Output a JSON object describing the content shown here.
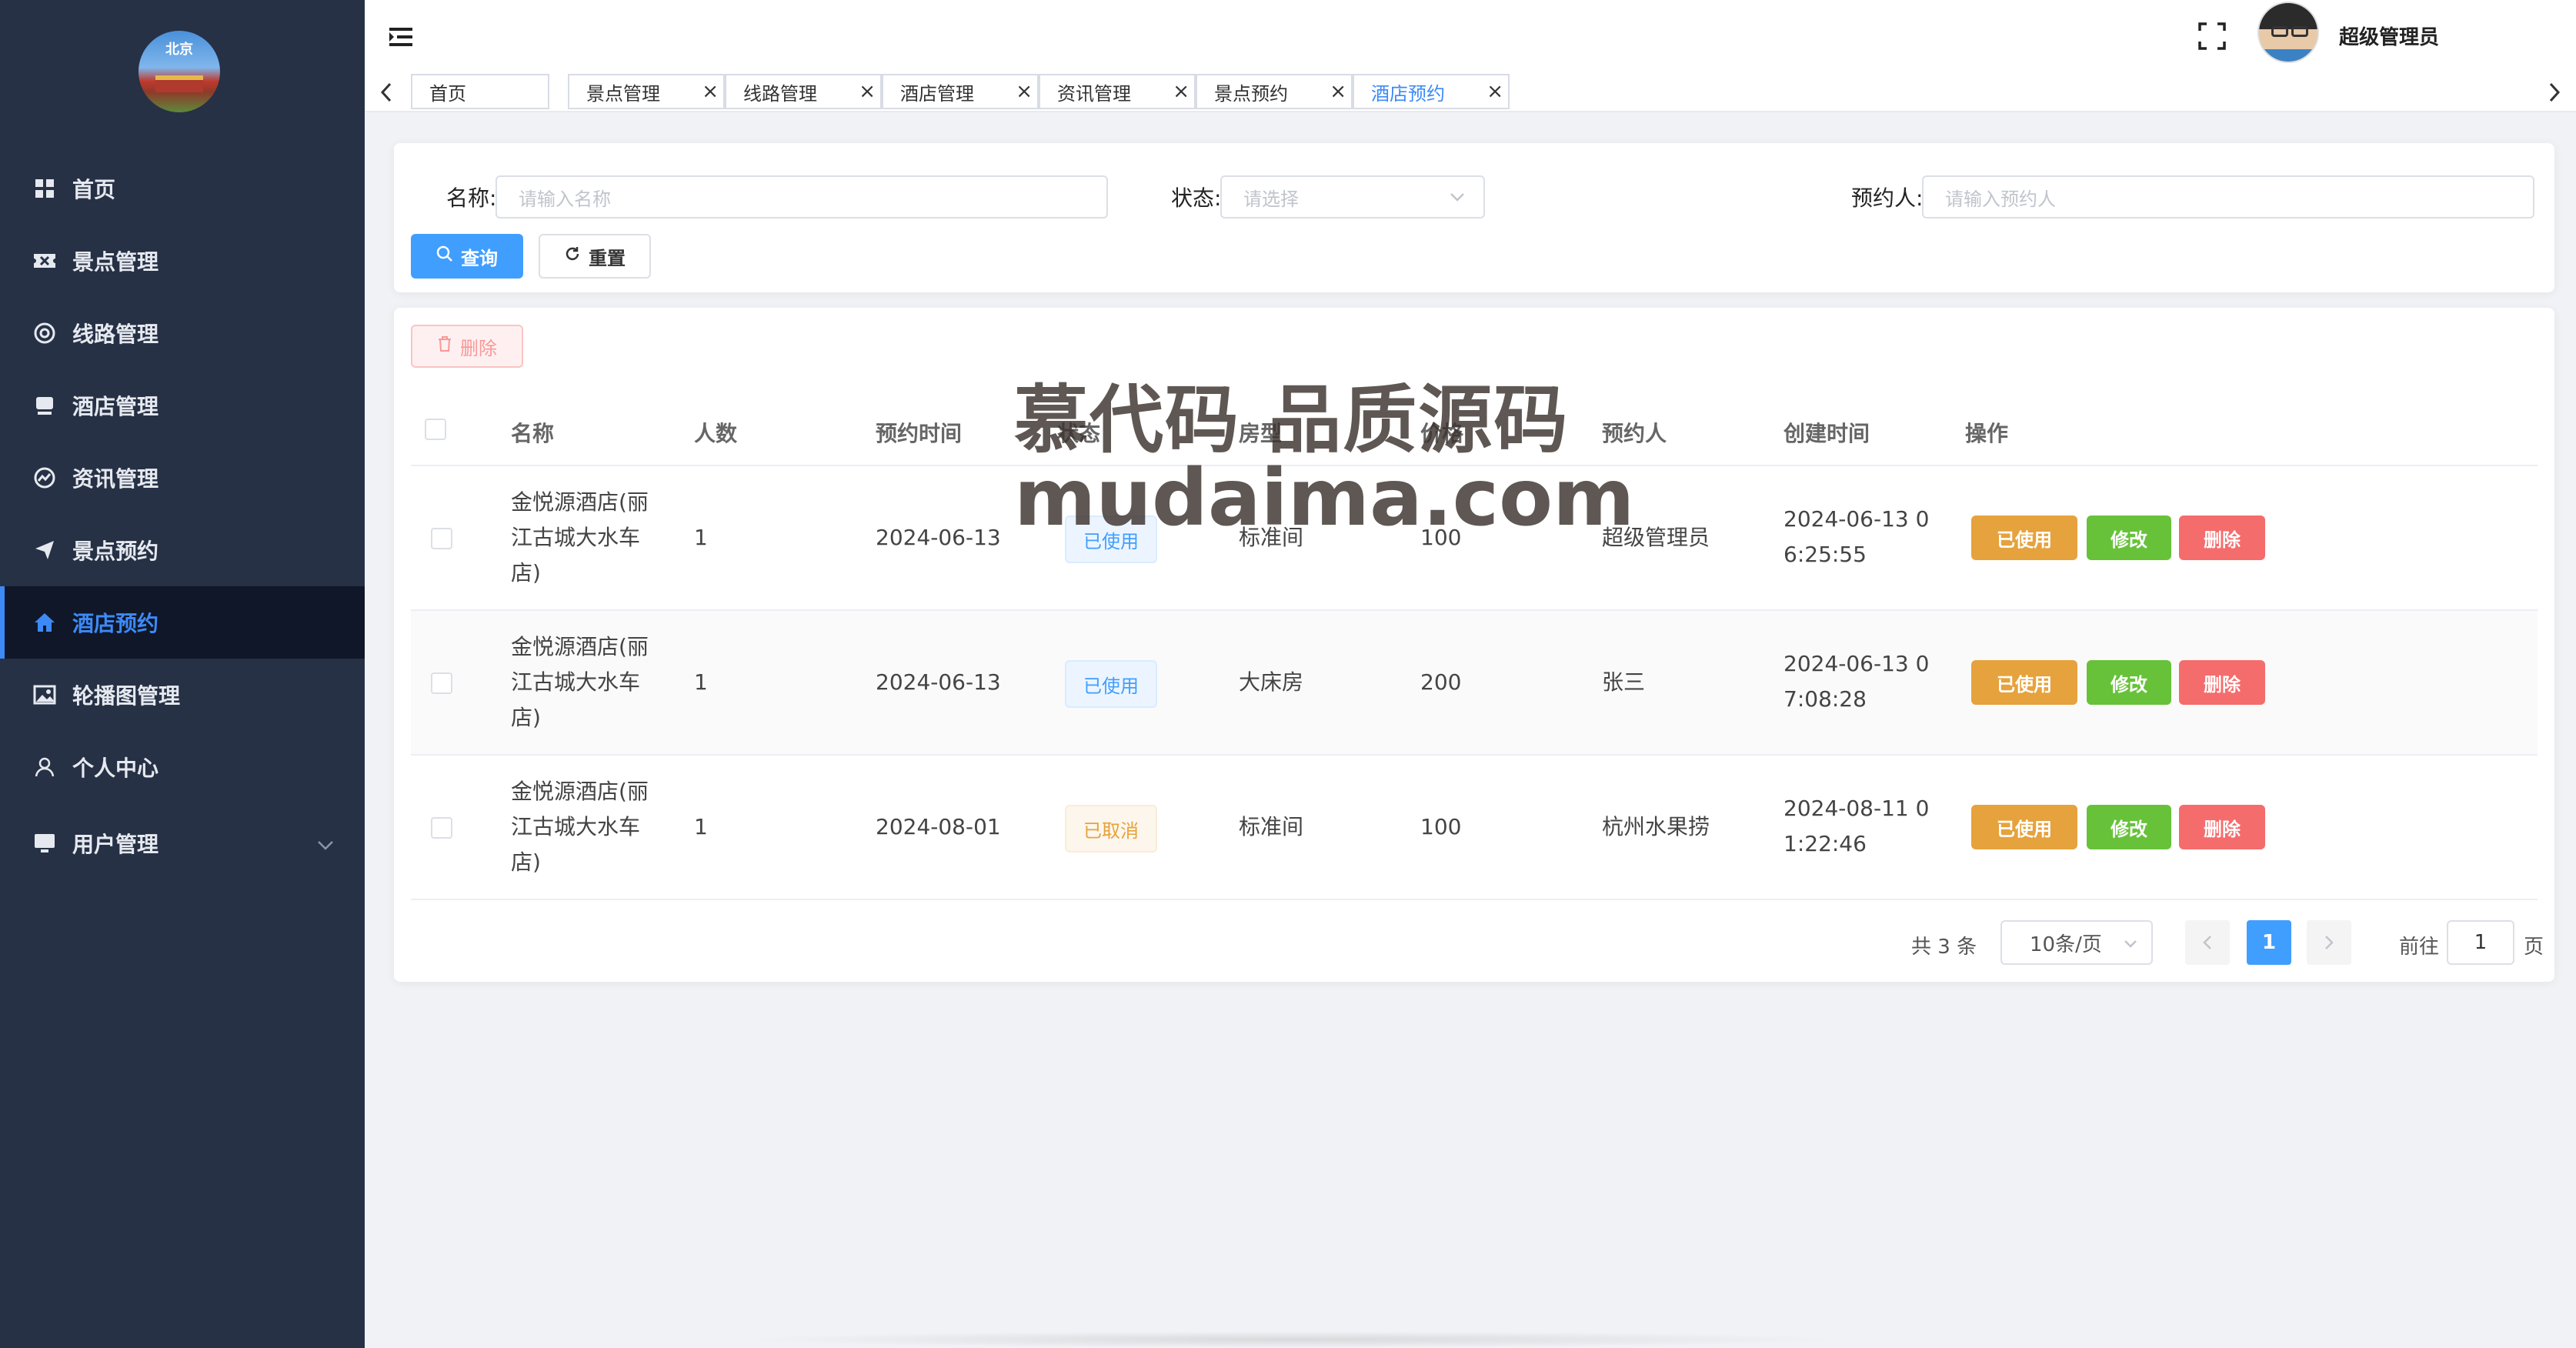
{
  "sidebar": {
    "logo_text": "北京",
    "items": [
      {
        "label": "首页",
        "icon": "dashboard-icon"
      },
      {
        "label": "景点管理",
        "icon": "ticket-icon"
      },
      {
        "label": "线路管理",
        "icon": "route-icon"
      },
      {
        "label": "酒店管理",
        "icon": "hotel-icon"
      },
      {
        "label": "资讯管理",
        "icon": "chart-icon"
      },
      {
        "label": "景点预约",
        "icon": "send-icon"
      },
      {
        "label": "酒店预约",
        "icon": "home-icon",
        "active": true
      },
      {
        "label": "轮播图管理",
        "icon": "image-icon"
      },
      {
        "label": "个人中心",
        "icon": "user-icon"
      },
      {
        "label": "用户管理",
        "icon": "monitor-icon"
      }
    ]
  },
  "header": {
    "username": "超级管理员"
  },
  "tags": [
    {
      "label": "首页",
      "closable": false
    },
    {
      "label": "景点管理",
      "closable": true
    },
    {
      "label": "线路管理",
      "closable": true
    },
    {
      "label": "酒店管理",
      "closable": true
    },
    {
      "label": "资讯管理",
      "closable": true
    },
    {
      "label": "景点预约",
      "closable": true
    },
    {
      "label": "酒店预约",
      "closable": true,
      "active": true
    }
  ],
  "search": {
    "name_label": "名称:",
    "name_placeholder": "请输入名称",
    "status_label": "状态:",
    "status_placeholder": "请选择",
    "booker_label": "预约人:",
    "booker_placeholder": "请输入预约人",
    "query_label": "查询",
    "reset_label": "重置"
  },
  "table": {
    "delete_label": "删除",
    "columns": [
      "名称",
      "人数",
      "预约时间",
      "状态",
      "房型",
      "价格",
      "预约人",
      "创建时间",
      "操作"
    ],
    "rows": [
      {
        "name_l1": "金悦源酒店(丽",
        "name_l2": "江古城大水车",
        "name_l3": "店)",
        "count": "1",
        "date": "2024-06-13",
        "status": "已使用",
        "room": "标准间",
        "price": "100",
        "booker": "超级管理员",
        "created_l1": "2024-06-13 0",
        "created_l2": "6:25:55"
      },
      {
        "name_l1": "金悦源酒店(丽",
        "name_l2": "江古城大水车",
        "name_l3": "店)",
        "count": "1",
        "date": "2024-06-13",
        "status": "已使用",
        "room": "大床房",
        "price": "200",
        "booker": "张三",
        "created_l1": "2024-06-13 0",
        "created_l2": "7:08:28"
      },
      {
        "name_l1": "金悦源酒店(丽",
        "name_l2": "江古城大水车",
        "name_l3": "店)",
        "count": "1",
        "date": "2024-08-01",
        "status": "已取消",
        "room": "标准间",
        "price": "100",
        "booker": "杭州水果捞",
        "created_l1": "2024-08-11 0",
        "created_l2": "1:22:46"
      }
    ],
    "actions": {
      "used": "已使用",
      "edit": "修改",
      "delete": "删除"
    }
  },
  "pagination": {
    "total": "共 3 条",
    "page_size": "10条/页",
    "current": "1",
    "goto_prefix": "前往",
    "goto_value": "1",
    "goto_suffix": "页"
  },
  "watermark": {
    "line1": "慕代码 品质源码",
    "line2": "mudaima.com"
  },
  "colors": {
    "sidebar_bg": "#263146",
    "accent": "#409eff",
    "warning": "#e6a23c",
    "success": "#67c23a",
    "danger": "#f56c6c"
  }
}
